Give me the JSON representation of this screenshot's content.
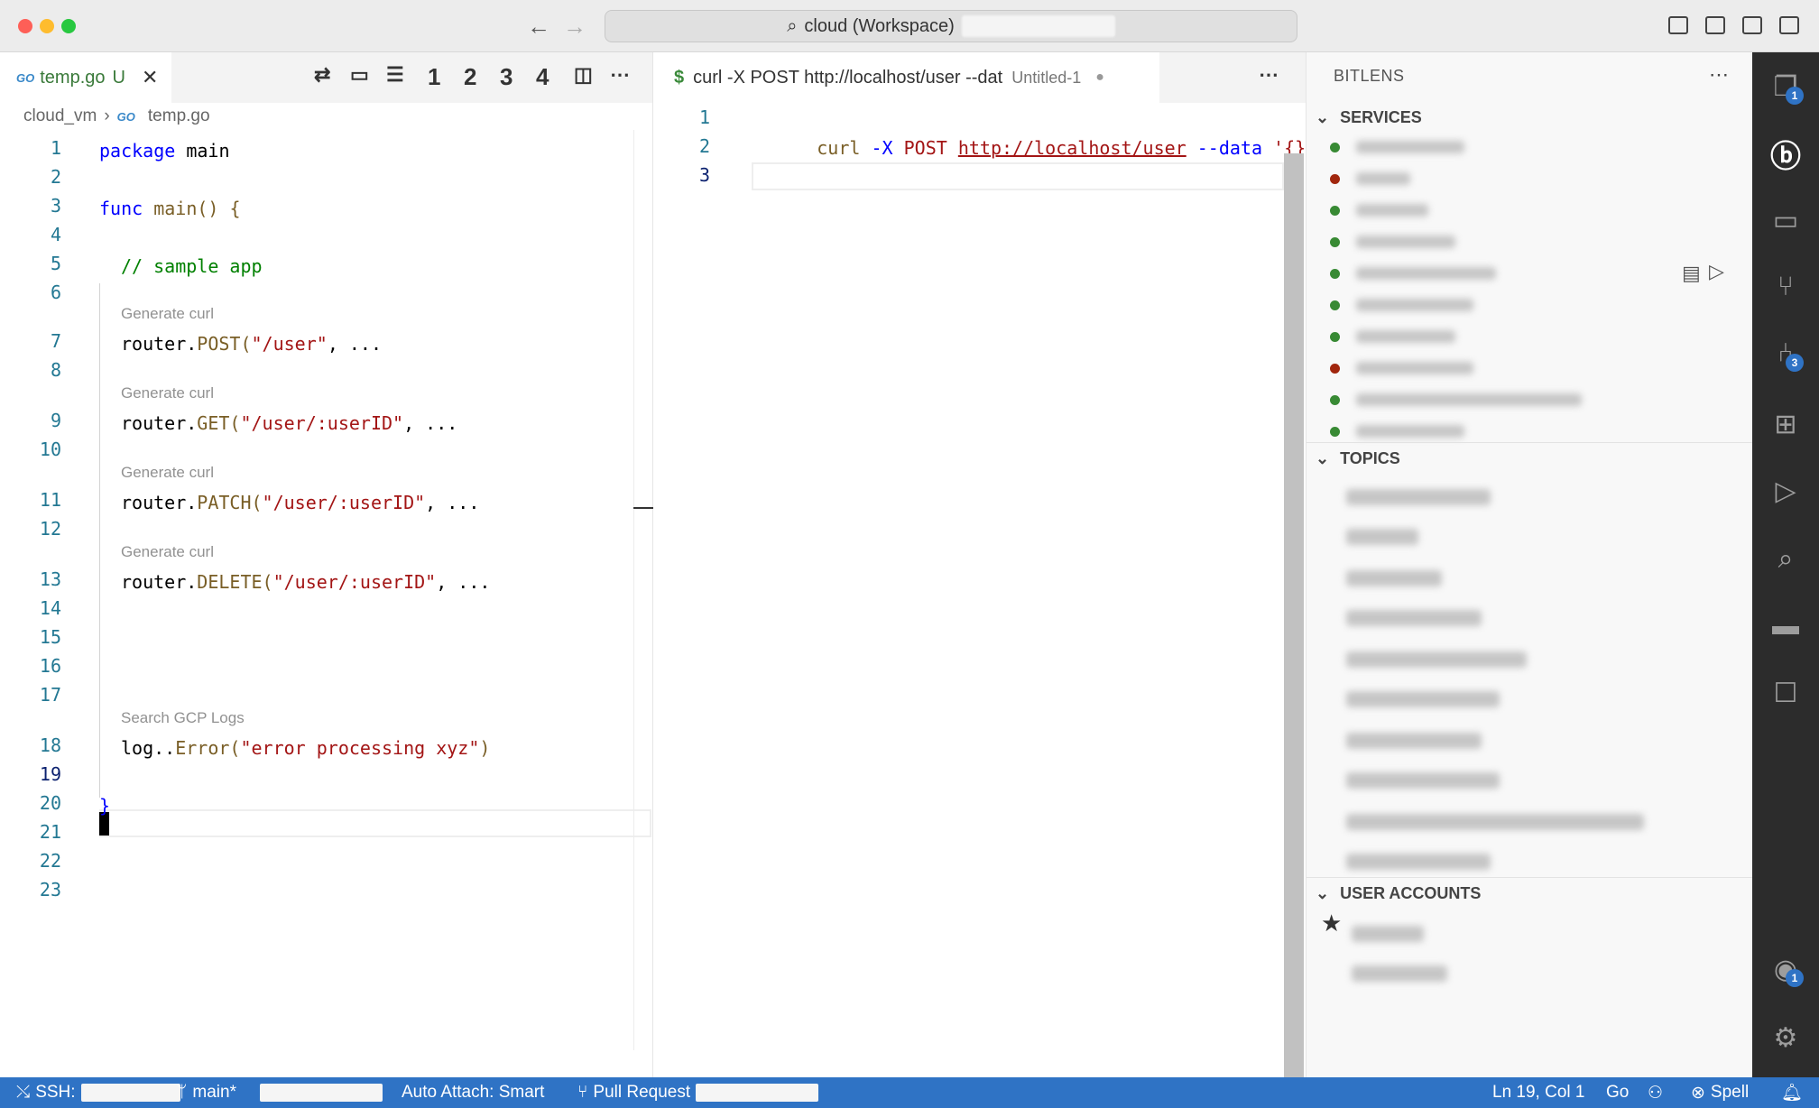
{
  "window": {
    "title": "cloud (Workspace)",
    "traffic_colors": [
      "#fe5f57",
      "#febc2e",
      "#28c840"
    ]
  },
  "left_editor": {
    "tab_label": "temp.go",
    "tab_badge": "U",
    "tab_icon": "GO",
    "toolbar_numbers": [
      "1",
      "2",
      "3",
      "4"
    ],
    "breadcrumb": [
      "cloud_vm",
      "temp.go"
    ],
    "line_numbers": [
      "1",
      "2",
      "3",
      "4",
      "5",
      "6",
      "7",
      "8",
      "9",
      "10",
      "11",
      "12",
      "13",
      "14",
      "15",
      "16",
      "17",
      "18",
      "19",
      "20",
      "21",
      "22",
      "23"
    ],
    "codelens": [
      "Generate curl",
      "Generate curl",
      "Generate curl",
      "Generate curl",
      "Search GCP Logs"
    ],
    "code": {
      "l1_kw": "package",
      "l1_rest": " main",
      "l3_kw": "func",
      "l3_rest": " main() {",
      "l5": "// sample app",
      "l7_a": "router.",
      "l7_b": "POST(",
      "l7_c": "\"/user\"",
      "l7_d": ", ...",
      "l9_a": "router.",
      "l9_b": "GET(",
      "l9_c": "\"/user/:userID\"",
      "l9_d": ", ...",
      "l11_a": "router.",
      "l11_b": "PATCH(",
      "l11_c": "\"/user/:userID\"",
      "l11_d": ", ...",
      "l13_a": "router.",
      "l13_b": "DELETE(",
      "l13_c": "\"/user/:userID\"",
      "l13_d": ", ...",
      "l18_a": "log..",
      "l18_b": "Error(",
      "l18_c": "\"error processing xyz\"",
      "l18_d": ")",
      "l20": "}"
    },
    "current_line": "19"
  },
  "middle_editor": {
    "tab_icon": "$",
    "tab_label": "curl -X POST http://localhost/user --dat",
    "tab_desc": "Untitled-1",
    "line_numbers": [
      "1",
      "2",
      "3"
    ],
    "code": {
      "cmd": "curl",
      "flag1": "-X",
      "method": "POST",
      "url": "http://localhost/user",
      "flag2": "--data",
      "data": "'{}'"
    }
  },
  "bitlens": {
    "title": "BITLENS",
    "services_header": "SERVICES",
    "topics_header": "TOPICS",
    "accounts_header": "USER ACCOUNTS",
    "service_status_colors": [
      "#388a34",
      "#a1260d",
      "#388a34",
      "#388a34",
      "#388a34",
      "#388a34",
      "#388a34",
      "#a1260d",
      "#388a34",
      "#388a34"
    ],
    "account_star": "★"
  },
  "activity_bar": {
    "icons": [
      "explorer-icon",
      "bitlens-icon",
      "remote-explorer-icon",
      "pull-request-icon",
      "source-control-icon",
      "extensions-icon",
      "run-debug-icon",
      "search-icon",
      "folder-icon",
      "comments-icon",
      "accounts-icon",
      "settings-gear-icon"
    ],
    "badges": {
      "explorer": "1",
      "source_control": "3",
      "accounts": "1"
    }
  },
  "status_bar": {
    "remote": "SSH:",
    "branch": "main*",
    "auto_attach": "Auto Attach: Smart",
    "pull_request": "Pull Request",
    "cursor": "Ln 19, Col 1",
    "language": "Go",
    "spell": "Spell"
  }
}
